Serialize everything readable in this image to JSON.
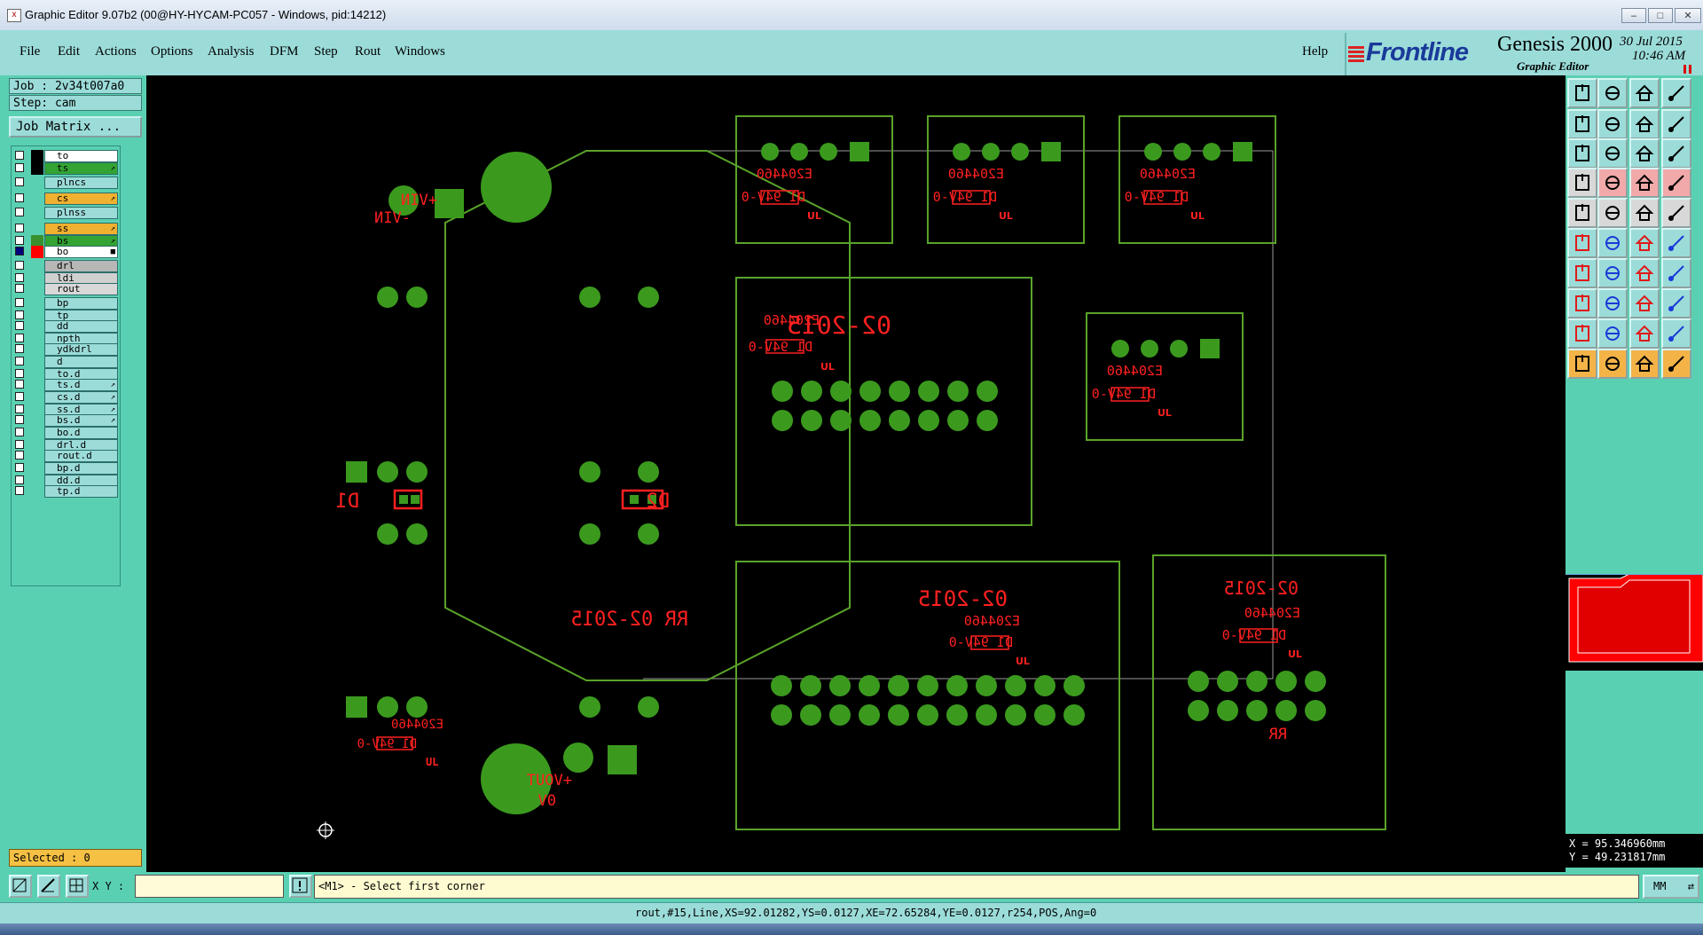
{
  "window": {
    "title": "Graphic Editor 9.07b2 (00@HY-HYCAM-PC057 - Windows, pid:14212)",
    "app_icon": "x-app-icon",
    "controls": [
      "minimize",
      "maximize",
      "close"
    ]
  },
  "menu": {
    "items": [
      "File",
      "Edit",
      "Actions",
      "Options",
      "Analysis",
      "DFM",
      "Step",
      "Rout",
      "Windows"
    ],
    "help": "Help"
  },
  "brand": {
    "logo": "Frontline",
    "product": "Genesis 2000",
    "subtitle": "Graphic Editor",
    "date": "30 Jul 2015",
    "time": "10:46 AM"
  },
  "left": {
    "job": "Job : 2v34t007a0",
    "step": "Step: cam",
    "job_matrix": "Job Matrix ...",
    "selected": "Selected : 0",
    "layers": [
      {
        "name": "to",
        "checked": false,
        "color": "#000000",
        "bg": "#ffffff",
        "arrow": ""
      },
      {
        "name": "ts",
        "checked": false,
        "color": "#000000",
        "bg": "#33a333",
        "arrow": "↗"
      },
      {
        "name": "plncs",
        "checked": false,
        "color": "",
        "bg": "#9bdcd9",
        "arrow": ""
      },
      {
        "name": "cs",
        "checked": false,
        "color": "",
        "bg": "#f0b030",
        "arrow": "↗"
      },
      {
        "name": "plnss",
        "checked": false,
        "color": "",
        "bg": "#9bdcd9",
        "arrow": ""
      },
      {
        "name": "ss",
        "checked": false,
        "color": "",
        "bg": "#f0b030",
        "arrow": "↗"
      },
      {
        "name": "bs",
        "checked": false,
        "color": "#3a8f2e",
        "bg": "#33a333",
        "arrow": "↗"
      },
      {
        "name": "bo",
        "checked": true,
        "color": "#ff0000",
        "bg": "#ffffff",
        "arrow": "■"
      },
      {
        "name": "drl",
        "checked": false,
        "color": "",
        "bg": "#b7b7b7",
        "arrow": ""
      },
      {
        "name": "ldi",
        "checked": false,
        "color": "",
        "bg": "#d0d0d0",
        "arrow": ""
      },
      {
        "name": "rout",
        "checked": false,
        "color": "",
        "bg": "#d8d8d8",
        "arrow": ""
      },
      {
        "name": "bp",
        "checked": false,
        "color": "",
        "bg": "#9bdcd9",
        "arrow": ""
      },
      {
        "name": "tp",
        "checked": false,
        "color": "",
        "bg": "#9bdcd9",
        "arrow": ""
      },
      {
        "name": "dd",
        "checked": false,
        "color": "",
        "bg": "#9bdcd9",
        "arrow": ""
      },
      {
        "name": "npth",
        "checked": false,
        "color": "",
        "bg": "#9bdcd9",
        "arrow": ""
      },
      {
        "name": "ydkdrl",
        "checked": false,
        "color": "",
        "bg": "#9bdcd9",
        "arrow": ""
      },
      {
        "name": "d",
        "checked": false,
        "color": "",
        "bg": "#9bdcd9",
        "arrow": ""
      },
      {
        "name": "to.d",
        "checked": false,
        "color": "",
        "bg": "#9bdcd9",
        "arrow": ""
      },
      {
        "name": "ts.d",
        "checked": false,
        "color": "",
        "bg": "#9bdcd9",
        "arrow": "↗"
      },
      {
        "name": "cs.d",
        "checked": false,
        "color": "",
        "bg": "#9bdcd9",
        "arrow": "↗"
      },
      {
        "name": "ss.d",
        "checked": false,
        "color": "",
        "bg": "#9bdcd9",
        "arrow": "↗"
      },
      {
        "name": "bs.d",
        "checked": false,
        "color": "",
        "bg": "#9bdcd9",
        "arrow": "↗"
      },
      {
        "name": "bo.d",
        "checked": false,
        "color": "",
        "bg": "#9bdcd9",
        "arrow": ""
      },
      {
        "name": "drl.d",
        "checked": false,
        "color": "",
        "bg": "#9bdcd9",
        "arrow": ""
      },
      {
        "name": "rout.d",
        "checked": false,
        "color": "",
        "bg": "#9bdcd9",
        "arrow": ""
      },
      {
        "name": "bp.d",
        "checked": false,
        "color": "",
        "bg": "#9bdcd9",
        "arrow": ""
      },
      {
        "name": "dd.d",
        "checked": false,
        "color": "",
        "bg": "#9bdcd9",
        "arrow": ""
      },
      {
        "name": "tp.d",
        "checked": false,
        "color": "",
        "bg": "#9bdcd9",
        "arrow": ""
      }
    ]
  },
  "canvas": {
    "labels": {
      "vin_plus": "+VIN",
      "vin_minus": "-VIN",
      "vout_plus": "+VOUT",
      "zero_v": "0V",
      "d1": "D1",
      "d2": "D2",
      "rr_date": "RR 02-2015",
      "date": "02-2015",
      "part": "E204460",
      "rating": "D1 94V-0",
      "ul": "UL",
      "rr": "RR"
    },
    "colors": {
      "outline": "#5aa32a",
      "pad": "#3b9a1e",
      "text": "#ff2020"
    }
  },
  "right": {
    "tools": [
      "open-step-icon",
      "save-icon",
      "home-icon",
      "layout-icon",
      "pan-left-icon",
      "pan-right-icon",
      "swap-icon",
      "snap-icon",
      "fit-icon",
      "zoom-center-icon",
      "scale-1-1-icon",
      "help-icon",
      "measure-icon",
      "probe-icon",
      "grid-red-icon",
      "grid-red2-icon",
      "record-icon",
      "select-area-icon",
      "ruler-icon",
      "dot-icon",
      "node-icon",
      "cross-icon",
      "link-icon",
      "diag-node-icon",
      "line-red-icon",
      "line-blue-icon",
      "arc-icon",
      "cut-icon",
      "snap-point-icon",
      "dash-icon",
      "frame-icon",
      "multi-select-icon",
      "triangle-icon",
      "triangle2-icon",
      "triangle3-icon",
      "triangle4-icon",
      "pointer-icon",
      "pointer-red-icon",
      "pointer-orange-icon",
      "route-icon"
    ],
    "x_coord": "X = 95.346960mm",
    "y_coord": "Y = 49.231817mm"
  },
  "bottom": {
    "xy_label": "X Y :",
    "xy_value": "",
    "prompt": "<M1> - Select first corner",
    "units": "MM",
    "status": "rout,#15,Line,XS=92.01282,YS=0.0127,XE=72.65284,YE=0.0127,r254,POS,Ang=0"
  }
}
